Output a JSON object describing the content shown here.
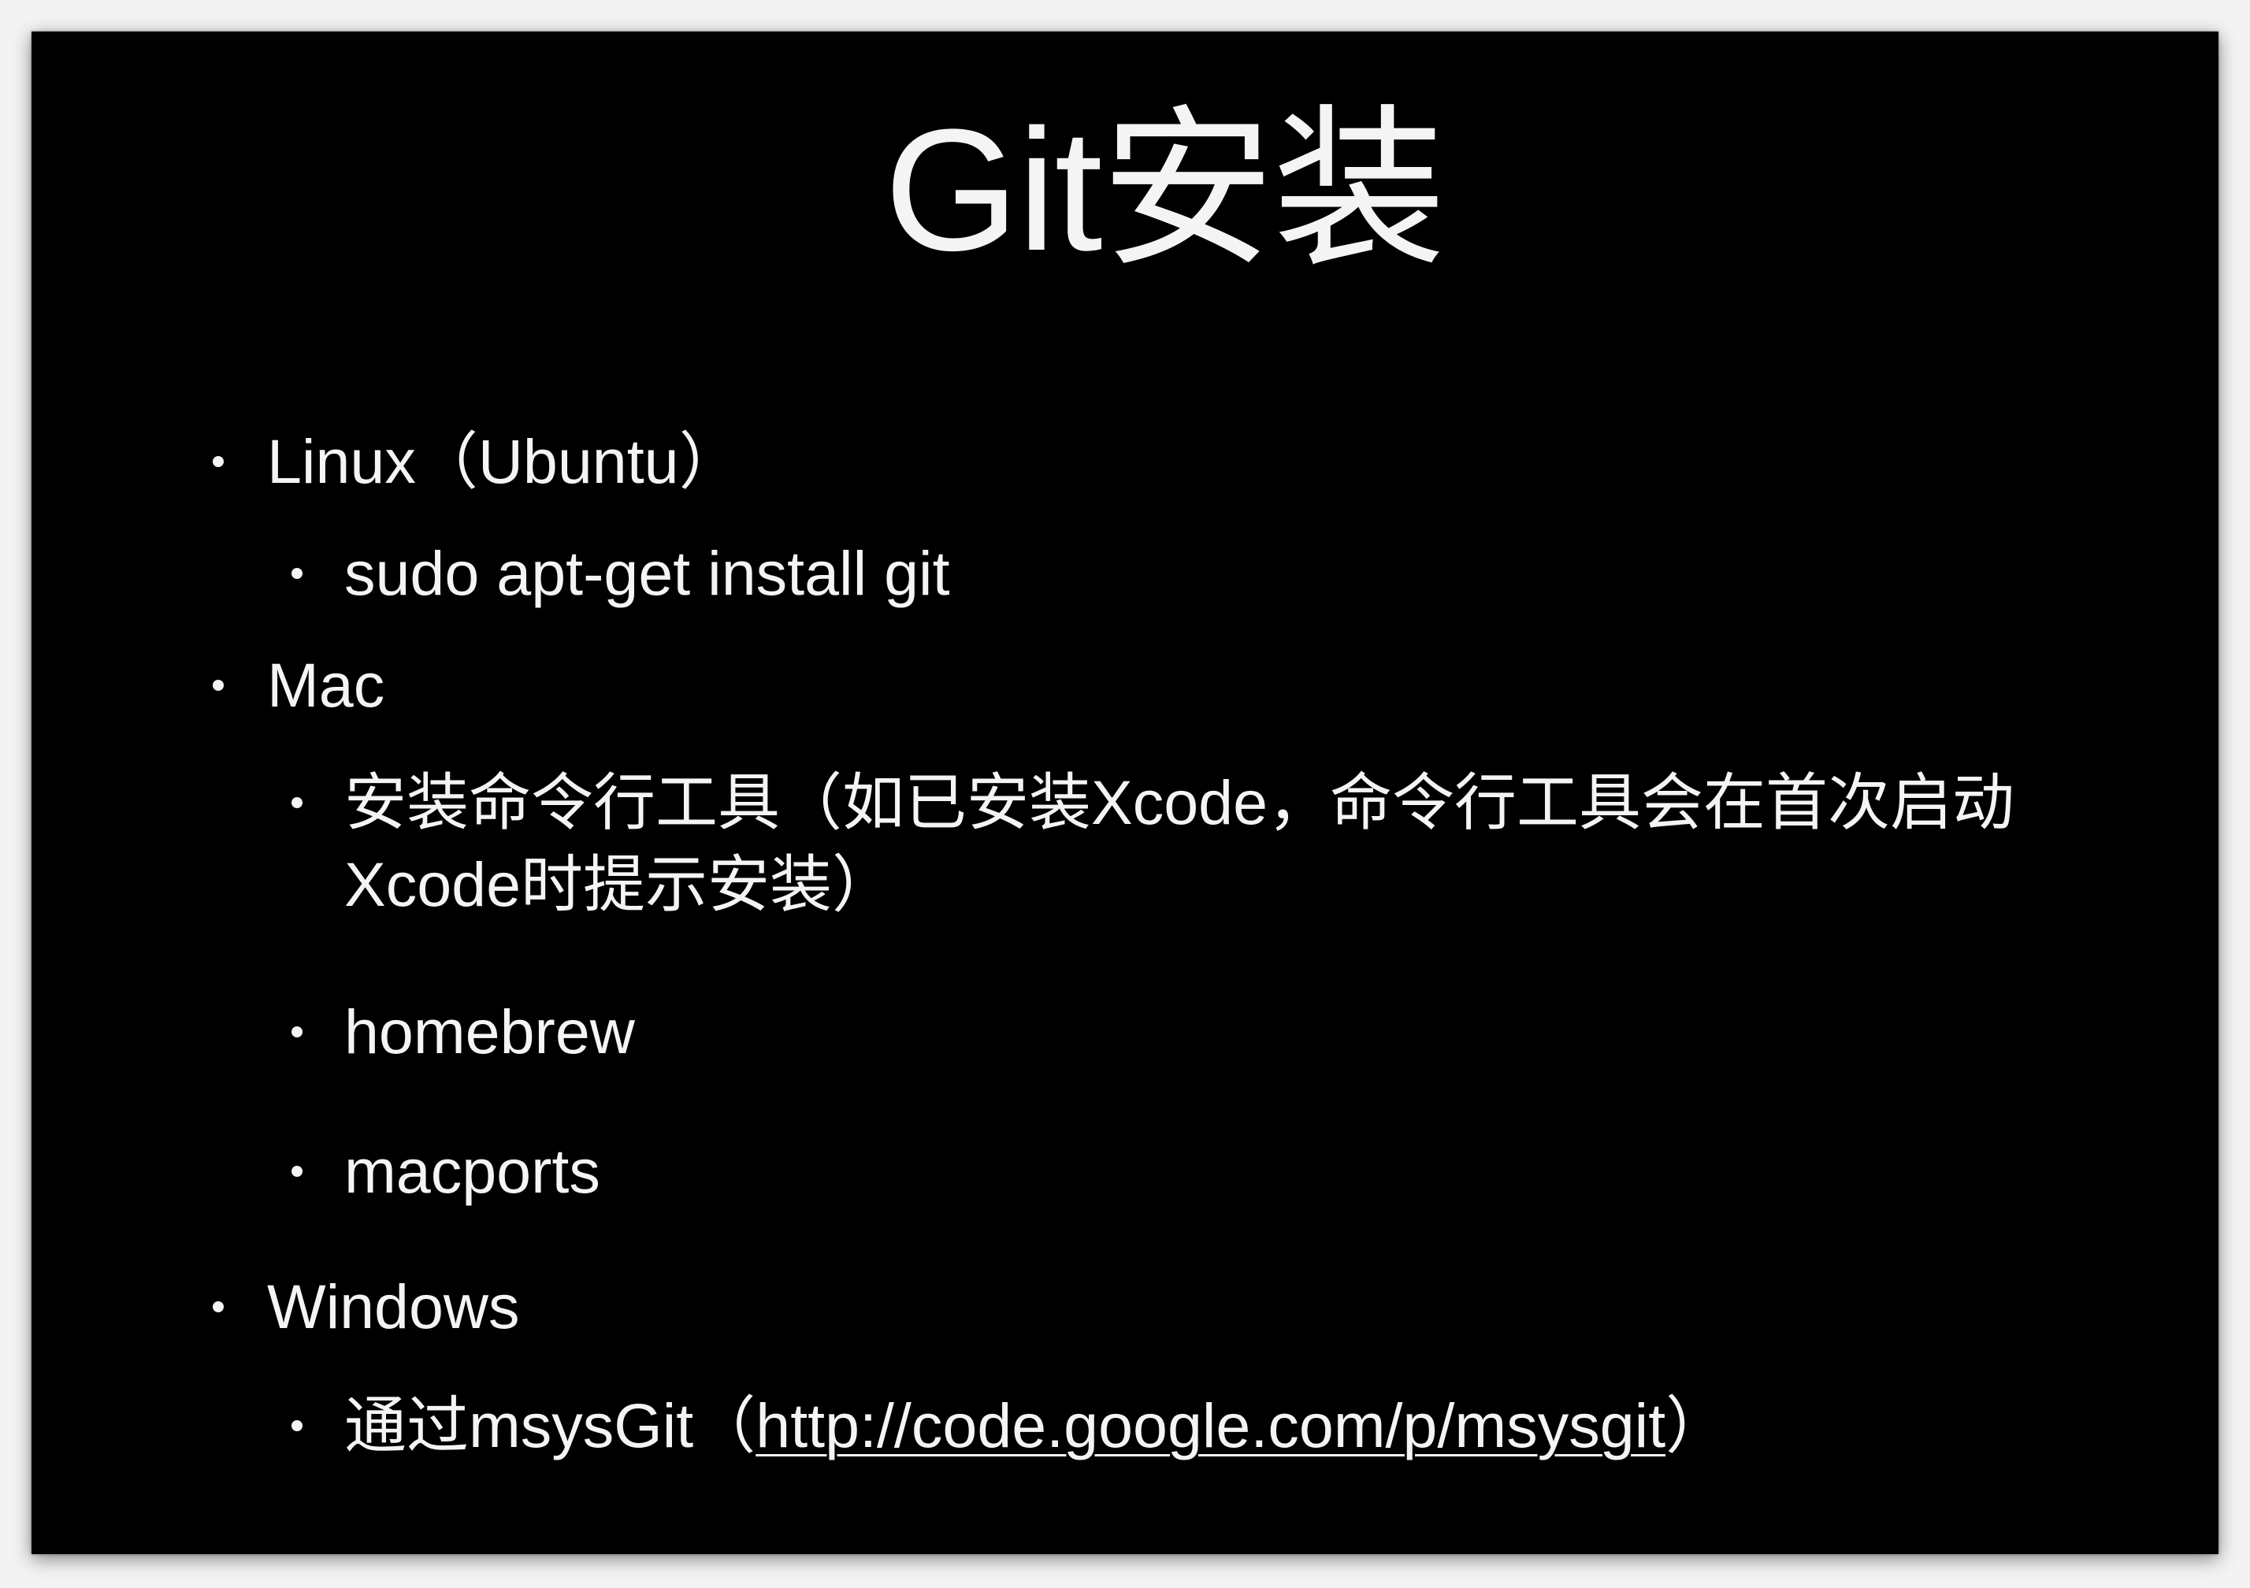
{
  "colors": {
    "page": "#f3f3f3",
    "slide_background": "#000000",
    "text": "#f4f4f4"
  },
  "slide": {
    "title": "Git安装",
    "bullets": [
      {
        "text": "Linux（Ubuntu）",
        "children": [
          {
            "text": "sudo apt-get install git"
          }
        ]
      },
      {
        "text": "Mac",
        "children": [
          {
            "lines": [
              "安装命令行工具（如已安装Xcode，命令行工具会在首次启动",
              "Xcode时提示安装）"
            ]
          },
          {
            "text": "homebrew"
          },
          {
            "text": "macports"
          }
        ]
      },
      {
        "text": "Windows",
        "children": [
          {
            "prefix": "通过msysGit（",
            "link": "http://code.google.com/p/msysgit",
            "suffix": "）"
          }
        ]
      }
    ]
  }
}
